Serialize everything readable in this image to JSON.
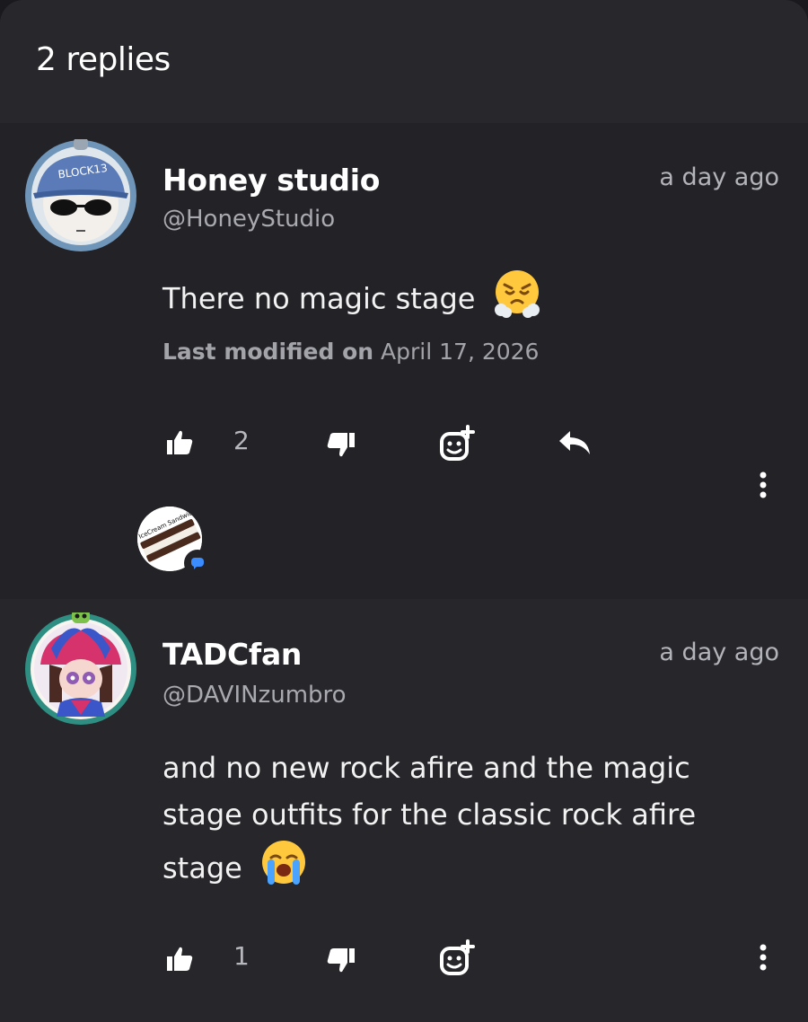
{
  "header": {
    "title": "2 replies"
  },
  "comments": [
    {
      "name": "Honey studio",
      "handle": "@HoneyStudio",
      "time": "a day ago",
      "text": "There no magic stage",
      "emoji": "steam-from-nose-emoji",
      "modified_label": "Last modified on",
      "modified_date": "April 17, 2026",
      "likes": "2",
      "avatar_text": "BLOCK13",
      "badge_text": "IceCream Sandwich"
    },
    {
      "name": "TADCfan",
      "handle": "@DAVINzumbro",
      "time": "a day ago",
      "text_lines": [
        "and no new rock afire and the magic",
        "stage outfits for the classic rock afire",
        "stage"
      ],
      "emoji": "loudly-crying-emoji",
      "likes": "1"
    }
  ],
  "colors": {
    "background": "#1a1a1e",
    "header": "#28282c",
    "card": "#222227",
    "muted": "#a9a9b0"
  }
}
